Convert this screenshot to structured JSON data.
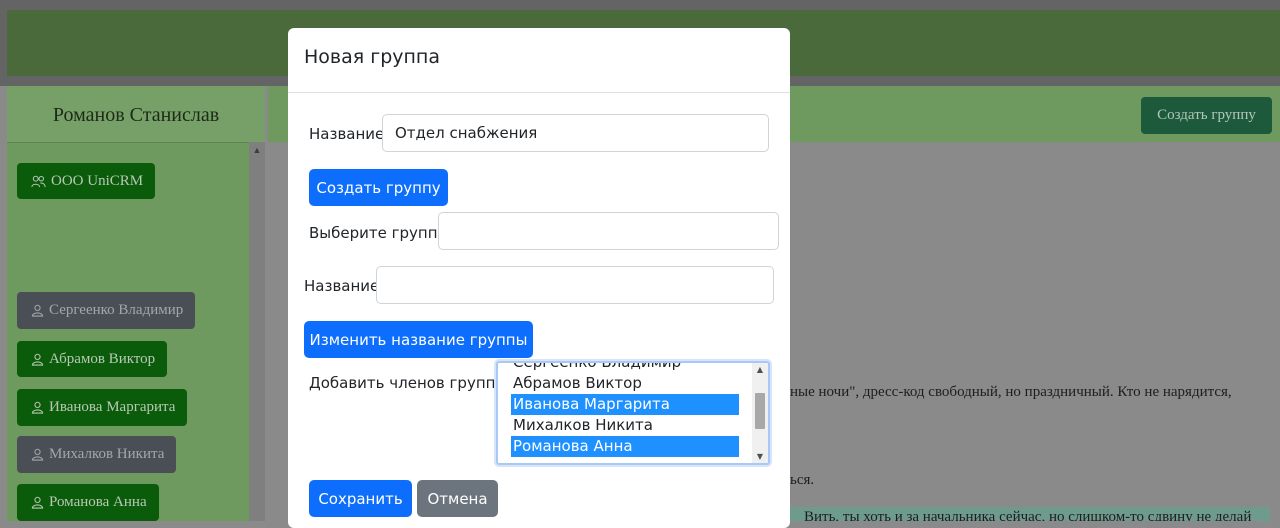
{
  "background": {
    "user_name": "Романов Станислав",
    "create_group_button": "Создать группу",
    "groups": [
      {
        "label": "ООО UniCRM",
        "icon": "users-icon"
      }
    ],
    "members": [
      {
        "label": "Сергеенко Владимир",
        "state": "inactive"
      },
      {
        "label": "Абрамов Виктор",
        "state": "active"
      },
      {
        "label": "Иванова Маргарита",
        "state": "active"
      },
      {
        "label": "Михалков Никита",
        "state": "inactive"
      },
      {
        "label": "Романова Анна",
        "state": "active"
      }
    ],
    "text_line1": "ные ночи\", дресс-код свободный, но праздничный. Кто не нарядится,",
    "text_line2": "ься.",
    "text_line3": "Вить, ты хоть и за начальника сейчас, но слишком-то сдвину не делай"
  },
  "modal": {
    "title": "Новая группа",
    "name_label": "Название:",
    "name_value": "Отдел снабжения",
    "create_button": "Создать группу",
    "select_group_label": "Выберите группу:",
    "select_group_value": "",
    "rename_label": "Название:",
    "rename_value": "",
    "rename_button": "Изменить название группы",
    "add_members_label": "Добавить членов группы:",
    "members_options": [
      {
        "label": "Сергеенко Владимир",
        "selected": false
      },
      {
        "label": "Абрамов Виктор",
        "selected": false
      },
      {
        "label": "Иванова Маргарита",
        "selected": true
      },
      {
        "label": "Михалков Никита",
        "selected": false
      },
      {
        "label": "Романова Анна",
        "selected": true
      }
    ],
    "save_button": "Сохранить",
    "cancel_button": "Отмена"
  },
  "colors": {
    "primary": "#0d6efd",
    "secondary": "#6c757d",
    "side_active": "#0a5b0a",
    "side_inactive": "#4a4f55",
    "header_green": "#4a6a3c"
  }
}
